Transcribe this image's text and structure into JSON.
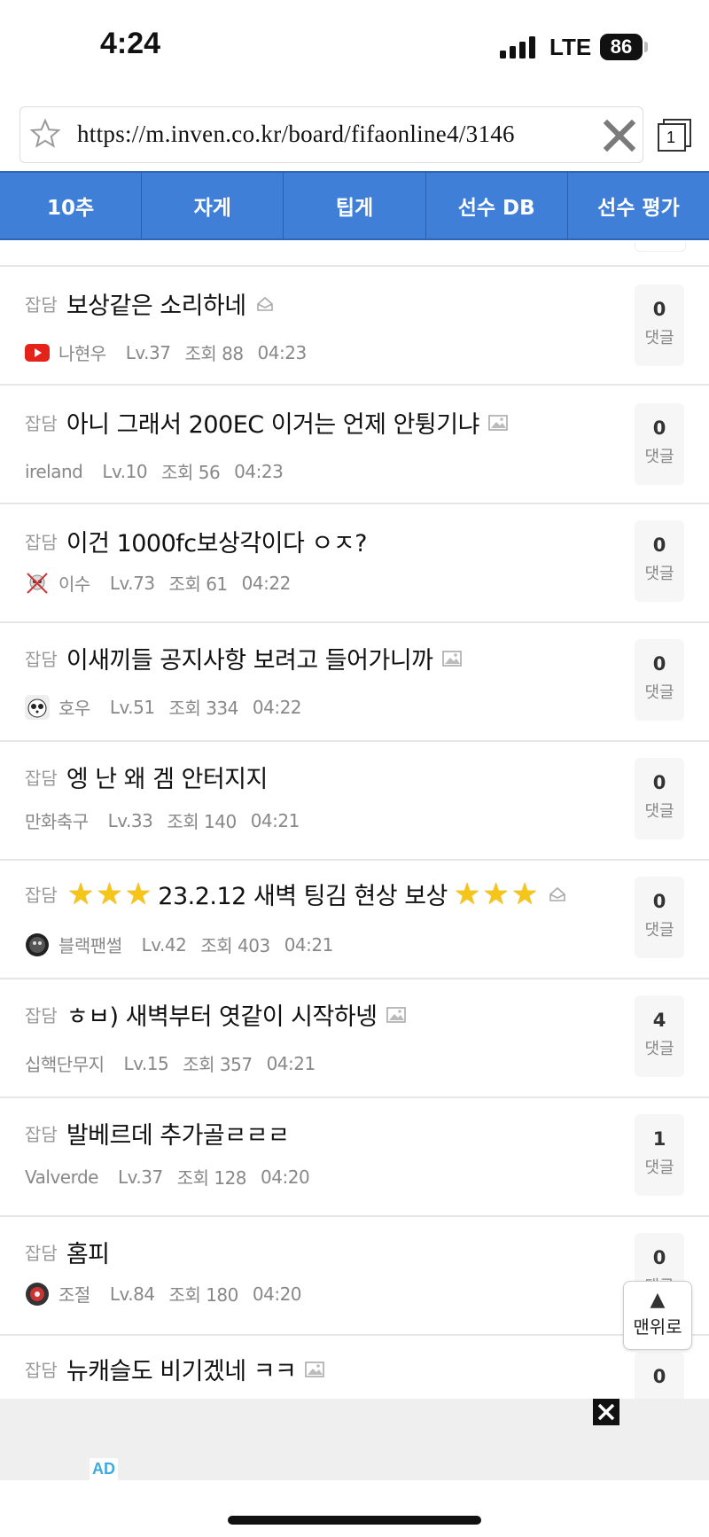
{
  "status": {
    "time": "4:24",
    "network": "LTE",
    "battery": "86"
  },
  "browser": {
    "url": "https://m.inven.co.kr/board/fifaonline4/3146",
    "tabs_count": "1"
  },
  "nav": {
    "items": [
      "10추",
      "자게",
      "팁게",
      "선수 DB",
      "선수 평가"
    ]
  },
  "posts": [
    {
      "category": "잡담",
      "title": "보상같은 소리하네",
      "icon": "hot-icon",
      "nickname": "나현우",
      "avatar": "youtube-avatar",
      "level": "Lv.37",
      "views": "조회 88",
      "time": "04:23",
      "comments": "0",
      "comment_label": "댓글"
    },
    {
      "category": "잡담",
      "title": "아니 그래서 200EC 이거는 언제 안튕기냐",
      "icon": "image-icon",
      "nickname": "ireland",
      "avatar": "",
      "level": "Lv.10",
      "views": "조회 56",
      "time": "04:23",
      "comments": "0",
      "comment_label": "댓글"
    },
    {
      "category": "잡담",
      "title": "이건 1000fc보상각이다 ㅇㅈ?",
      "icon": "",
      "nickname": "이수",
      "avatar": "skull-avatar",
      "level": "Lv.73",
      "views": "조회 61",
      "time": "04:22",
      "comments": "0",
      "comment_label": "댓글"
    },
    {
      "category": "잡담",
      "title": "이새끼들 공지사항 보려고 들어가니까",
      "icon": "image-icon",
      "nickname": "호우",
      "avatar": "panda-avatar",
      "level": "Lv.51",
      "views": "조회 334",
      "time": "04:22",
      "comments": "0",
      "comment_label": "댓글"
    },
    {
      "category": "잡담",
      "title": "엥 난 왜 겜 안터지지",
      "icon": "",
      "nickname": "만화축구",
      "avatar": "",
      "level": "Lv.33",
      "views": "조회 140",
      "time": "04:21",
      "comments": "0",
      "comment_label": "댓글"
    },
    {
      "category": "잡담",
      "title": "23.2.12 새벽 팅김 현상 보상",
      "icon": "hot-icon",
      "nickname": "블랙팬썰",
      "avatar": "panther-avatar",
      "level": "Lv.42",
      "views": "조회 403",
      "time": "04:21",
      "comments": "0",
      "comment_label": "댓글"
    },
    {
      "category": "잡담",
      "title": "ㅎㅂ) 새벽부터 엿같이 시작하넹",
      "icon": "image-icon",
      "nickname": "십핵단무지",
      "avatar": "",
      "level": "Lv.15",
      "views": "조회 357",
      "time": "04:21",
      "comments": "4",
      "comment_label": "댓글"
    },
    {
      "category": "잡담",
      "title": "발베르데 추가골ㄹㄹㄹ",
      "icon": "",
      "nickname": "Valverde",
      "avatar": "",
      "level": "Lv.37",
      "views": "조회 128",
      "time": "04:20",
      "comments": "1",
      "comment_label": "댓글"
    },
    {
      "category": "잡담",
      "title": "홈피",
      "icon": "",
      "nickname": "조절",
      "avatar": "ball-avatar",
      "level": "Lv.84",
      "views": "조회 180",
      "time": "04:20",
      "comments": "0",
      "comment_label": "댓글"
    },
    {
      "category": "잡담",
      "title": "뉴캐슬도 비기겠네 ㅋㅋ",
      "icon": "image-icon",
      "nickname": "",
      "avatar": "",
      "level": "",
      "views": "",
      "time": "",
      "comments": "0",
      "comment_label": ""
    }
  ],
  "to_top": {
    "arrow": "▲",
    "label": "맨위로"
  },
  "ad": {
    "label": "AD"
  }
}
